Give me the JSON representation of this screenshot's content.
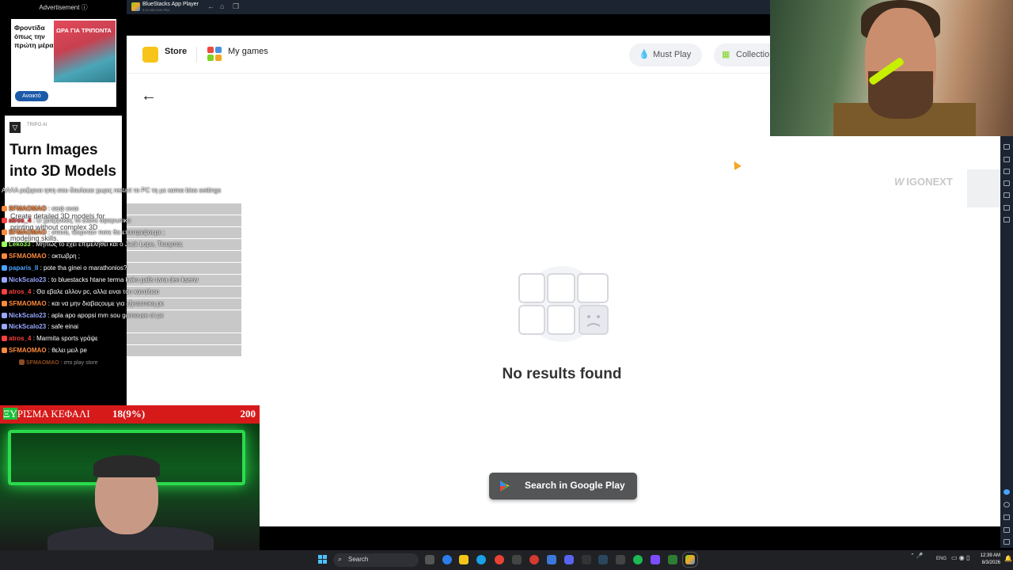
{
  "ads": {
    "header": "Advertisement ⓘ",
    "ad1": {
      "text": "Φροντίδα όπως την πρώτη μέρα",
      "image_label": "ΩΡΑ ΓΙΑ ΤΡΙΠΟΝΤΑ",
      "button": "Ανοικτό"
    },
    "ad2": {
      "brand": "TRIPO AI",
      "headline": "Turn Images into 3D Models",
      "description": "Create detailed 3D models for printing without complex 3D modeling skills."
    }
  },
  "chat": [
    {
      "user": "",
      "text": "ΑΛΛΑ ρεζερνα ηπη σου δουλευει χωρις restart το PC τη με καπια bios settings",
      "color": "#ffffff"
    },
    {
      "user": "SFMAOMAO",
      "text": "σειψ ειναι",
      "color": "#ff8a3d"
    },
    {
      "user": "atros_4",
      "text": "Ο χατζηνικος το εκανε αφιερωτικα",
      "color": "#ff4040"
    },
    {
      "user": "SFMAOMAO",
      "text": "σπινα, τέορνταν ποτε θα επιστρεψουμε ;",
      "color": "#ff8a3d"
    },
    {
      "user": "Leko33",
      "text": "Μηπως το εχει επιμεληθει και ο Jack Lope, Τιουμπα;",
      "color": "#9cff5a"
    },
    {
      "user": "SFMAOMAO",
      "text": "οκτωβρη ;",
      "color": "#ff8a3d"
    },
    {
      "user": "paparis_II",
      "text": "pote tha ginei o marathonios?",
      "color": "#4aa3ff"
    },
    {
      "user": "NickScalo23",
      "text": "to bluestacks htane terma kako palis twra den kserw",
      "color": "#9aa8ff"
    },
    {
      "user": "atros_4",
      "text": "Θα εβαλε αλλον pc, αλλα ειναι του καναλιου",
      "color": "#ff4040"
    },
    {
      "user": "SFMAOMAO",
      "text": "και να μην διαβαςουμε για εξεταστικη pc",
      "color": "#ff8a3d"
    },
    {
      "user": "NickScalo23",
      "text": "apla apo apopsi mm sou gamouse ot pc",
      "color": "#9aa8ff"
    },
    {
      "user": "NickScalo23",
      "text": "safe einai",
      "color": "#9aa8ff"
    },
    {
      "user": "atros_4",
      "text": "Marmita sports γράψε",
      "color": "#ff4040"
    },
    {
      "user": "SFMAOMAO",
      "text": "θελει μειλ pe",
      "color": "#ff8a3d"
    },
    {
      "user": "SFMAOMAO",
      "text": "στο play store",
      "color": "#ff8a3d"
    }
  ],
  "bluestacks": {
    "title": "BlueStacks App Player",
    "subtitle": "5.22.155.1031 P64",
    "nav": {
      "store": "Store",
      "my_games": "My games",
      "must_play": "Must Play",
      "collections": "Collectio"
    },
    "empty_state": "No results found",
    "search_button": "Search in Google Play"
  },
  "watermark": "IGONEXT",
  "score": {
    "word_highlight": "ΞΥ",
    "word_rest": "ΡΙΣΜΑ ΚΕΦΑΛΙ",
    "percent": "18(9%)",
    "number": "200"
  },
  "taskbar": {
    "search": "Search",
    "lang": "ENG",
    "time": "12:39 AM",
    "date": "8/3/2026"
  }
}
